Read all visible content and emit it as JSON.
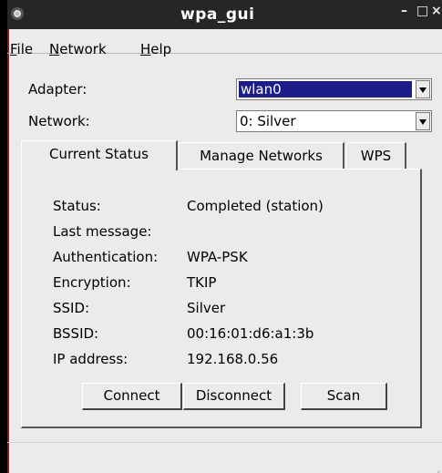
{
  "window": {
    "title": "wpa_gui",
    "minimize": "–",
    "maximize": "□",
    "close": "×"
  },
  "menu": [
    {
      "accel": "F",
      "rest": "ile"
    },
    {
      "accel": "N",
      "rest": "etwork"
    },
    {
      "accel": "H",
      "rest": "elp"
    }
  ],
  "adapter": {
    "label": "Adapter:",
    "value": "wlan0"
  },
  "network": {
    "label": "Network:",
    "value": "0: Silver"
  },
  "tabs": [
    "Current Status",
    "Manage Networks",
    "WPS"
  ],
  "status": {
    "rows": [
      {
        "label": "Status:",
        "value": "Completed (station)"
      },
      {
        "label": "Last message:",
        "value": ""
      },
      {
        "label": "Authentication:",
        "value": "WPA-PSK"
      },
      {
        "label": "Encryption:",
        "value": "TKIP"
      },
      {
        "label": "SSID:",
        "value": "Silver"
      },
      {
        "label": "BSSID:",
        "value": "00:16:01:d6:a1:3b"
      },
      {
        "label": "IP address:",
        "value": "192.168.0.56"
      }
    ]
  },
  "buttons": {
    "connect": "Connect",
    "disconnect": "Disconnect",
    "scan": "Scan"
  },
  "colors": {
    "titlebar": "#262626",
    "window": "#ecebe9",
    "selection": "#1c1c8a"
  }
}
